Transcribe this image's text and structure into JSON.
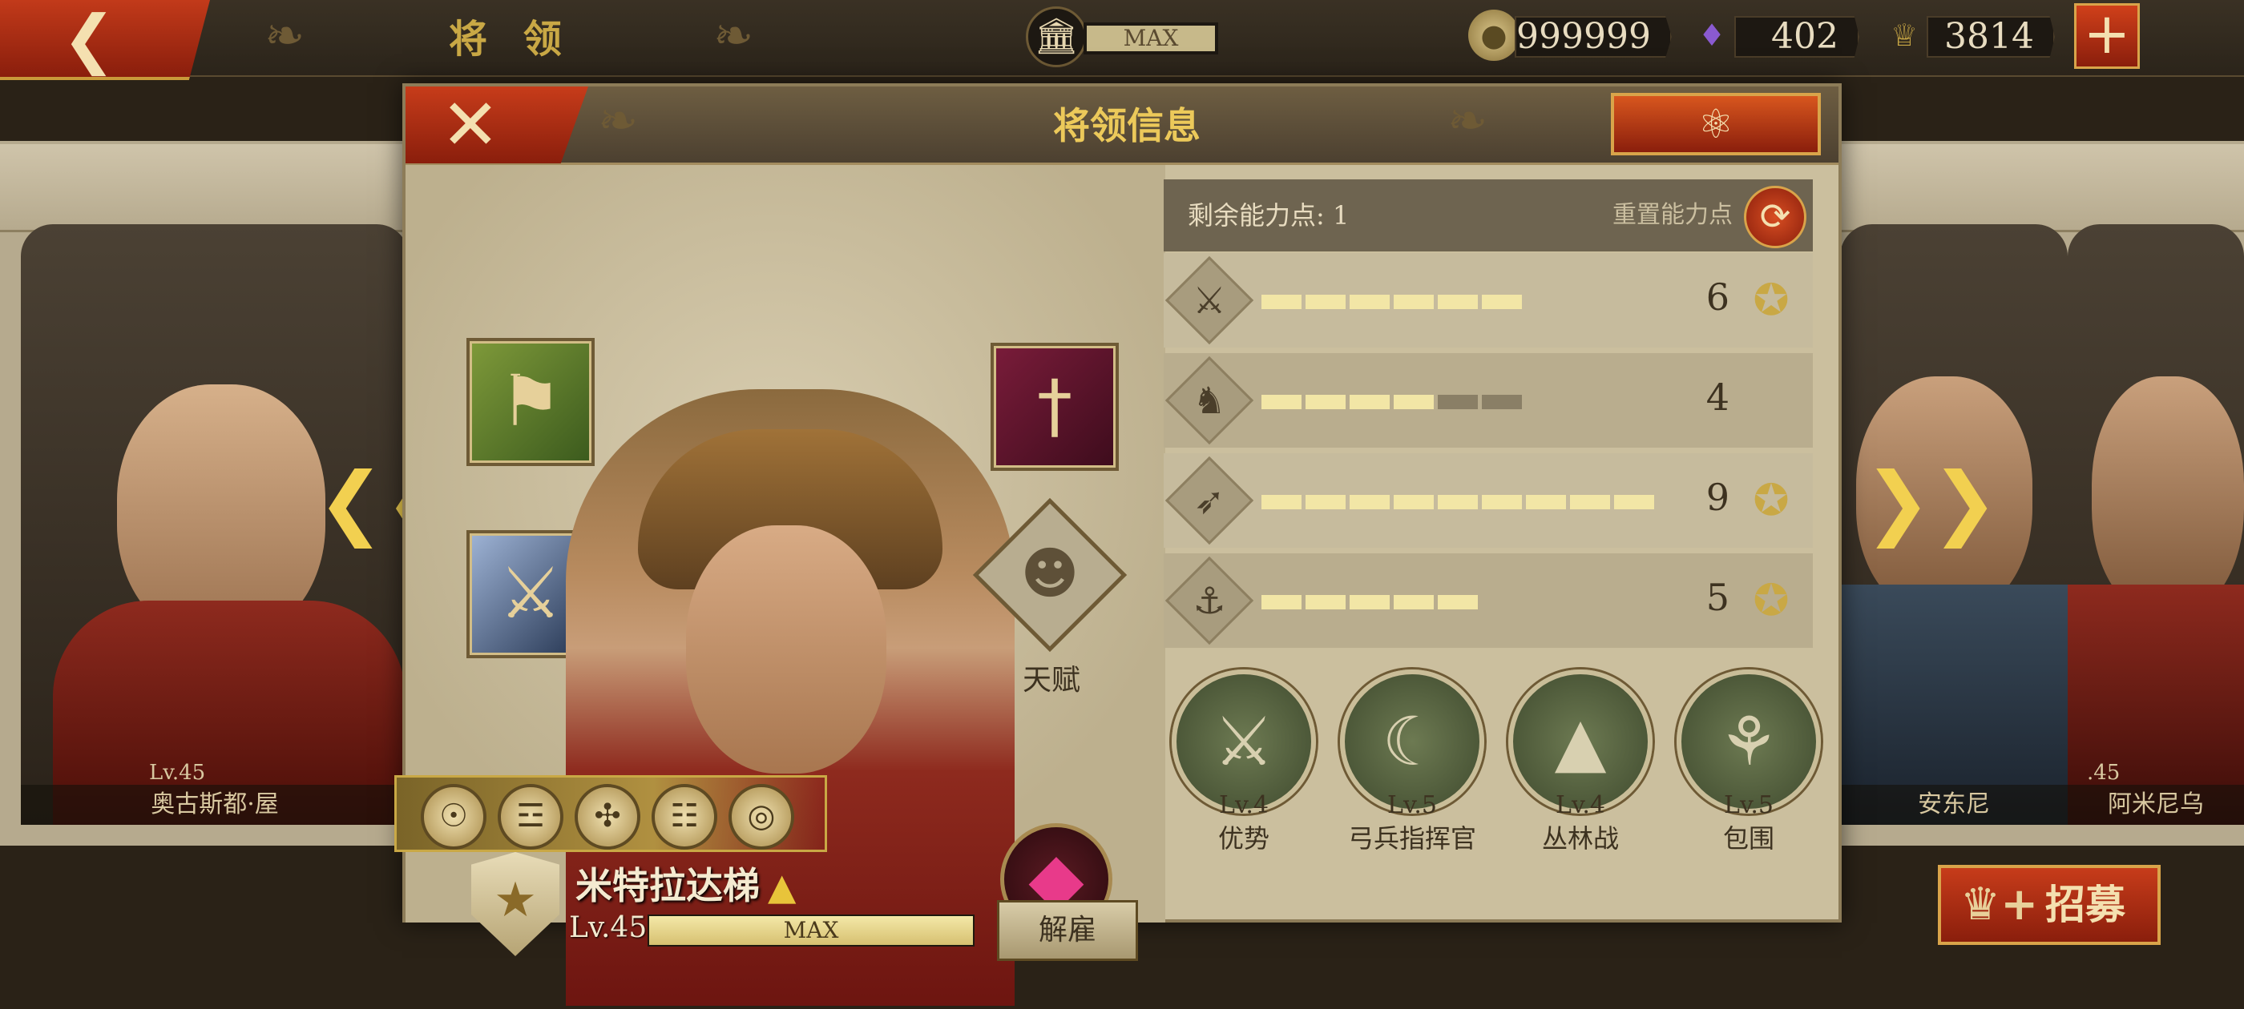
{
  "topbar": {
    "back_icon": "back-chevron-icon",
    "title": "将 领",
    "building_level": "MAX",
    "gold": "999999",
    "gems": "402",
    "spqr": "3814",
    "plus_icon": "plus-icon"
  },
  "dialog": {
    "title": "将领信息",
    "close_icon": "close-icon",
    "eagle_icon": "eagle-icon"
  },
  "hero": {
    "name": "米特拉达梯",
    "level": "Lv.45",
    "xp_text": "MAX",
    "xp_fraction": 1.0,
    "talent_label": "天赋",
    "dismiss_label": "解雇",
    "equipment": [
      "banner-icon",
      "sword-icon",
      "dagger-icon"
    ],
    "medals": [
      "medal-icon",
      "medal-icon",
      "medal-icon",
      "medal-icon",
      "medal-icon"
    ]
  },
  "stats": {
    "ability_points_label": "剩余能力点: 1",
    "reset_label": "重置能力点",
    "rows": [
      {
        "icon": "sword-icon",
        "value": "6",
        "filled": 6,
        "total": 6,
        "badge": true
      },
      {
        "icon": "cavalry-icon",
        "value": "4",
        "filled": 4,
        "total": 6,
        "badge": false
      },
      {
        "icon": "bow-icon",
        "value": "9",
        "filled": 9,
        "total": 9,
        "badge": true
      },
      {
        "icon": "anchor-icon",
        "value": "5",
        "filled": 5,
        "total": 5,
        "badge": true
      }
    ]
  },
  "skills": [
    {
      "lv": "Lv.4",
      "name": "优势",
      "icon": "archers-icon"
    },
    {
      "lv": "Lv.5",
      "name": "弓兵指挥官",
      "icon": "bow-icon"
    },
    {
      "lv": "Lv.4",
      "name": "丛林战",
      "icon": "forest-icon"
    },
    {
      "lv": "Lv.5",
      "name": "包围",
      "icon": "encircle-icon"
    }
  ],
  "side_cards": {
    "left_name": "奥古斯都·屋",
    "left_level": "Lv.45",
    "right1_name": "安东尼",
    "right2_name": "阿米尼乌",
    "right_level": ".45"
  },
  "recruit_label": "招募",
  "colors": {
    "accent_red": "#b2300f",
    "gold": "#ecc95a",
    "pip_filled": "#f2e6a6",
    "pip_empty": "#8a7f66"
  }
}
